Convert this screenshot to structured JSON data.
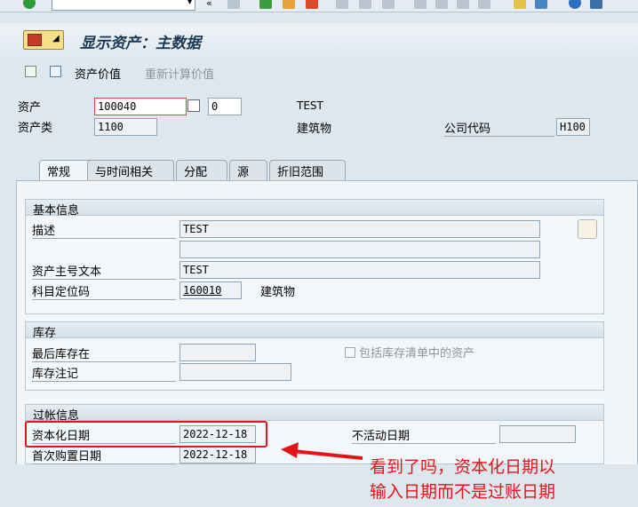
{
  "title": "显示资产：主数据",
  "app_toolbar": {
    "asset_value": "资产价值",
    "recalc_value": "重新计算价值"
  },
  "header": {
    "asset_label": "资产",
    "asset_number": "100040",
    "sub_number": "0",
    "asset_desc": "TEST",
    "class_label": "资产类",
    "class_value": "1100",
    "class_desc": "建筑物",
    "company_label": "公司代码",
    "company_value": "H100"
  },
  "tabs": [
    "常规",
    "与时间相关",
    "分配",
    "源",
    "折旧范围"
  ],
  "basic_info": {
    "title": "基本信息",
    "desc_label": "描述",
    "desc_value1": "TEST",
    "desc_value2": "",
    "main_text_label": "资产主号文本",
    "main_text_value": "TEST",
    "acct_label": "科目定位码",
    "acct_value": "160010",
    "acct_desc": "建筑物"
  },
  "inventory": {
    "title": "库存",
    "last_inv_label": "最后库存在",
    "last_inv_value": "",
    "include_label": "包括库存清单中的资产",
    "include_checked": false,
    "inv_note_label": "库存注记",
    "inv_note_value": ""
  },
  "posting": {
    "title": "过帐信息",
    "cap_date_label": "资本化日期",
    "cap_date_value": "2022-12-18",
    "inactive_label": "不活动日期",
    "inactive_value": "",
    "first_acq_label": "首次购置日期",
    "first_acq_value": "2022-12-18"
  },
  "annotation": {
    "line1": "看到了吗，资本化日期以",
    "line2": "输入日期而不是过账日期"
  }
}
